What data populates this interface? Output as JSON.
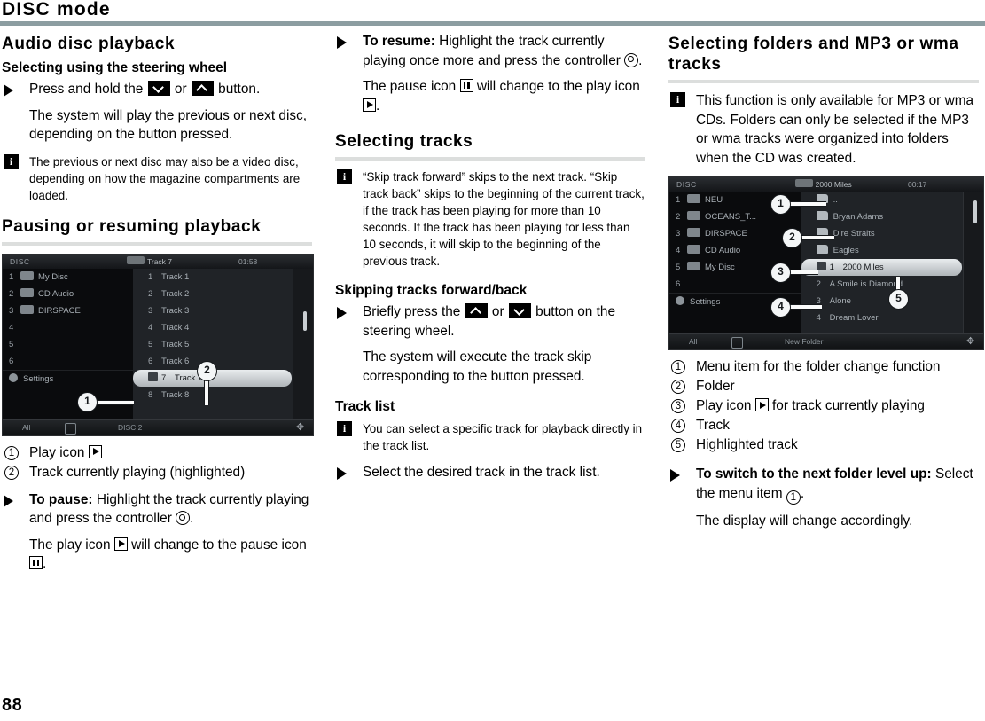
{
  "head": {
    "running_title": "DISC mode",
    "rule_color": "#8c9da1"
  },
  "folio": "88",
  "col1": {
    "section_title": "Audio disc playback",
    "sub1": "Selecting using the steering wheel",
    "bullet1_pre": "Press and hold the",
    "bullet1_mid": "or",
    "bullet1_post": "button.",
    "para1": "The system will play the previous or next disc, depending on the button pressed.",
    "note1": "The previous or next disc may also be a video disc, depending on how the magazine compartments are loaded.",
    "sub2": "Pausing or resuming playback",
    "screenshot": {
      "topbar": {
        "source": "DISC",
        "title": "Track 7",
        "time": "01:58"
      },
      "botbar": {
        "left": "All",
        "center": "DISC 2"
      },
      "left_list": [
        {
          "idx": "1",
          "label": "My Disc"
        },
        {
          "idx": "2",
          "label": "CD Audio"
        },
        {
          "idx": "3",
          "label": "DIRSPACE"
        },
        {
          "idx": "4",
          "label": ""
        },
        {
          "idx": "5",
          "label": ""
        },
        {
          "idx": "6",
          "label": ""
        },
        {
          "idx": "",
          "label": "Settings"
        }
      ],
      "right_list": [
        {
          "idx": "1",
          "label": "Track 1"
        },
        {
          "idx": "2",
          "label": "Track 2"
        },
        {
          "idx": "3",
          "label": "Track 3"
        },
        {
          "idx": "4",
          "label": "Track 4"
        },
        {
          "idx": "5",
          "label": "Track 5"
        },
        {
          "idx": "6",
          "label": "Track 6"
        },
        {
          "idx": "7",
          "label": "Track 7"
        },
        {
          "idx": "8",
          "label": "Track 8"
        }
      ],
      "highlighted_index": 6,
      "callouts": [
        "1",
        "2"
      ]
    },
    "legend": [
      {
        "num": "1",
        "text_before": "Play icon ",
        "icon": "play-icon",
        "text_after": ""
      },
      {
        "num": "2",
        "text_before": "Track currently playing (highlighted)",
        "icon": "",
        "text_after": ""
      }
    ],
    "bullet2_bold": "To pause:",
    "bullet2_rest": "Highlight the track currently playing and press the controller",
    "bullet2_end": ".",
    "para2_a": "The play icon",
    "para2_b": "will change to the pause icon",
    "para2_c": "."
  },
  "col2": {
    "bullet1_bold": "To resume:",
    "bullet1_rest": "Highlight the track currently playing once more and press the controller",
    "bullet1_end": ".",
    "para1_a": "The pause icon",
    "para1_b": "will change to the play icon",
    "para1_c": ".",
    "sub1": "Selecting tracks",
    "note1": "“Skip track forward” skips to the next track. “Skip track back” skips to the beginning of the current track, if the track has been playing for more than 10 seconds. If the track has been playing for less than 10 seconds, it will skip to the beginning of the previous track.",
    "sub2": "Skipping tracks forward/back",
    "bullet2_pre": "Briefly press the",
    "bullet2_mid": "or",
    "bullet2_post": "button on the steering wheel.",
    "para2": "The system will execute the track skip corresponding to the button pressed.",
    "sub3": "Track list",
    "note2": "You can select a specific track for playback directly in the track list.",
    "bullet3": "Select the desired track in the track list."
  },
  "col3": {
    "section_title": "Selecting folders and MP3 or wma tracks",
    "note1": "This function is only available for MP3 or wma CDs. Folders can only be selected if the MP3 or wma tracks were organized into folders when the CD was created.",
    "screenshot": {
      "topbar": {
        "source": "DISC",
        "title": "2000 Miles",
        "time": "00:17"
      },
      "botbar": {
        "left": "All",
        "center": "New Folder"
      },
      "left_list": [
        {
          "idx": "1",
          "label": "NEU"
        },
        {
          "idx": "2",
          "label": "OCEANS_T..."
        },
        {
          "idx": "3",
          "label": "DIRSPACE"
        },
        {
          "idx": "4",
          "label": "CD Audio"
        },
        {
          "idx": "5",
          "label": "My Disc"
        },
        {
          "idx": "6",
          "label": ""
        },
        {
          "idx": "",
          "label": "Settings"
        }
      ],
      "right_list": [
        {
          "idx": "",
          "label": "..",
          "kind": "folder-up"
        },
        {
          "idx": "",
          "label": "Bryan Adams",
          "kind": "folder"
        },
        {
          "idx": "",
          "label": "Dire Straits",
          "kind": "folder"
        },
        {
          "idx": "",
          "label": "Eagles",
          "kind": "folder"
        },
        {
          "idx": "1",
          "label": "2000 Miles",
          "kind": "track"
        },
        {
          "idx": "2",
          "label": "A Smile is Diamond",
          "kind": "track"
        },
        {
          "idx": "3",
          "label": "Alone",
          "kind": "track"
        },
        {
          "idx": "4",
          "label": "Dream Lover",
          "kind": "track"
        }
      ],
      "highlighted_index": 4,
      "callouts": [
        "1",
        "2",
        "3",
        "4",
        "5"
      ]
    },
    "legend": [
      {
        "num": "1",
        "text_before": "Menu item for the folder change function",
        "icon": "",
        "text_after": ""
      },
      {
        "num": "2",
        "text_before": "Folder",
        "icon": "",
        "text_after": ""
      },
      {
        "num": "3",
        "text_before": "Play icon ",
        "icon": "play-icon",
        "text_after": " for track currently playing"
      },
      {
        "num": "4",
        "text_before": "Track",
        "icon": "",
        "text_after": ""
      },
      {
        "num": "5",
        "text_before": "Highlighted track",
        "icon": "",
        "text_after": ""
      }
    ],
    "bullet1_bold": "To switch to the next folder level up:",
    "bullet1_rest": "Select the menu item",
    "bullet1_num": "1",
    "bullet1_end": ".",
    "para1": "The display will change accordingly."
  }
}
